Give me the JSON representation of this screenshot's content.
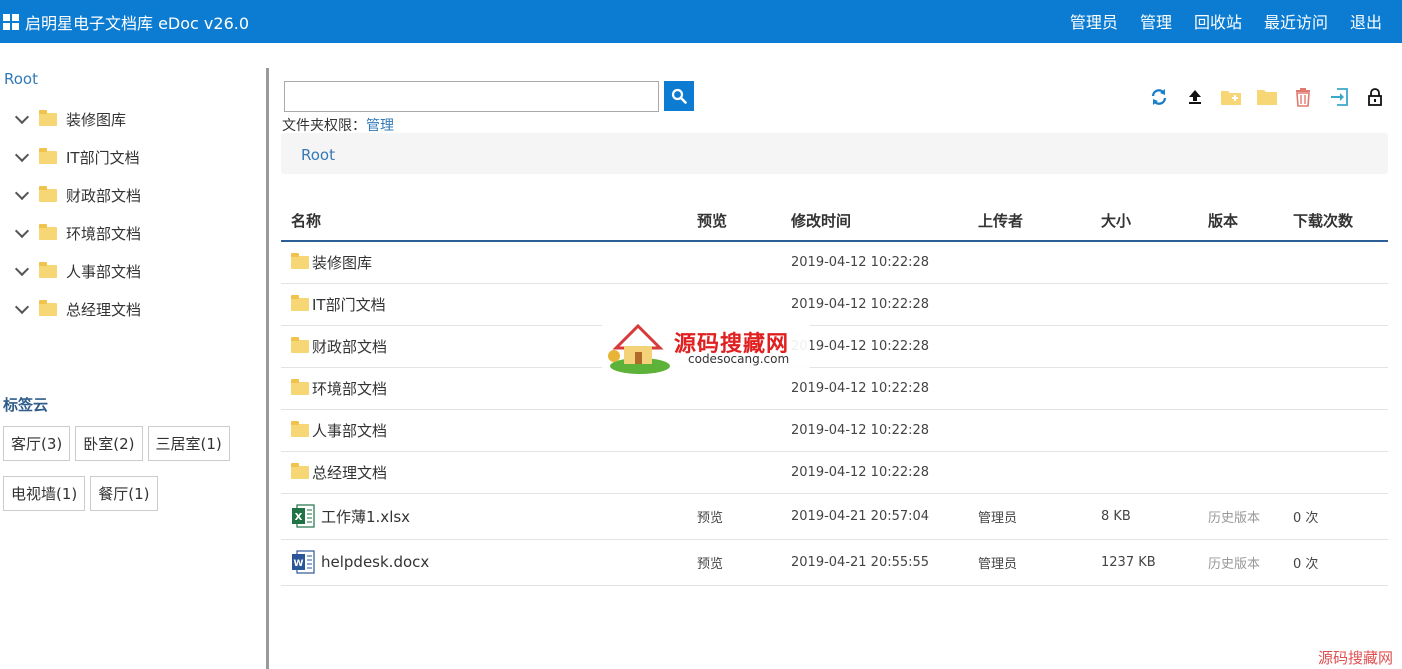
{
  "app": {
    "title": "启明星电子文档库 eDoc v26.0"
  },
  "nav": [
    "管理员",
    "管理",
    "回收站",
    "最近访问",
    "退出"
  ],
  "sidebar": {
    "root": "Root",
    "folders": [
      "装修图库",
      "IT部门文档",
      "财政部文档",
      "环境部文档",
      "人事部文档",
      "总经理文档"
    ],
    "tags_title": "标签云",
    "tags": [
      "客厅(3)",
      "卧室(2)",
      "三居室(1)",
      "电视墙(1)",
      "餐厅(1)"
    ]
  },
  "search": {
    "value": "",
    "placeholder": ""
  },
  "permission": {
    "label": "文件夹权限：",
    "value": "管理"
  },
  "breadcrumb": "Root",
  "toolbar_icons": [
    "refresh-icon",
    "upload-icon",
    "new-folder-icon",
    "folder-icon",
    "trash-icon",
    "move-icon",
    "lock-icon"
  ],
  "colors": {
    "topbar": "#0b7cd1",
    "link": "#337ab7",
    "folder": "#f7d675",
    "trash": "#e07a6e",
    "move": "#3aa8c9"
  },
  "table": {
    "headers": [
      "名称",
      "预览",
      "修改时间",
      "上传者",
      "大小",
      "版本",
      "下载次数"
    ],
    "rows": [
      {
        "type": "folder",
        "name": "装修图库",
        "preview": "",
        "modified": "2019-04-12 10:22:28",
        "uploader": "",
        "size": "",
        "version": "",
        "downloads": ""
      },
      {
        "type": "folder",
        "name": "IT部门文档",
        "preview": "",
        "modified": "2019-04-12 10:22:28",
        "uploader": "",
        "size": "",
        "version": "",
        "downloads": ""
      },
      {
        "type": "folder",
        "name": "财政部文档",
        "preview": "",
        "modified": "2019-04-12 10:22:28",
        "uploader": "",
        "size": "",
        "version": "",
        "downloads": ""
      },
      {
        "type": "folder",
        "name": "环境部文档",
        "preview": "",
        "modified": "2019-04-12 10:22:28",
        "uploader": "",
        "size": "",
        "version": "",
        "downloads": ""
      },
      {
        "type": "folder",
        "name": "人事部文档",
        "preview": "",
        "modified": "2019-04-12 10:22:28",
        "uploader": "",
        "size": "",
        "version": "",
        "downloads": ""
      },
      {
        "type": "folder",
        "name": "总经理文档",
        "preview": "",
        "modified": "2019-04-12 10:22:28",
        "uploader": "",
        "size": "",
        "version": "",
        "downloads": ""
      },
      {
        "type": "xlsx",
        "name": "工作薄1.xlsx",
        "preview": "预览",
        "modified": "2019-04-21 20:57:04",
        "uploader": "管理员",
        "size": "8 KB",
        "version": "历史版本",
        "downloads": "0 次"
      },
      {
        "type": "docx",
        "name": "helpdesk.docx",
        "preview": "预览",
        "modified": "2019-04-21 20:55:55",
        "uploader": "管理员",
        "size": "1237 KB",
        "version": "历史版本",
        "downloads": "0 次"
      }
    ]
  },
  "watermark": {
    "title": "源码搜藏网",
    "sub": "codesocang.com",
    "corner": "源码搜藏网"
  }
}
